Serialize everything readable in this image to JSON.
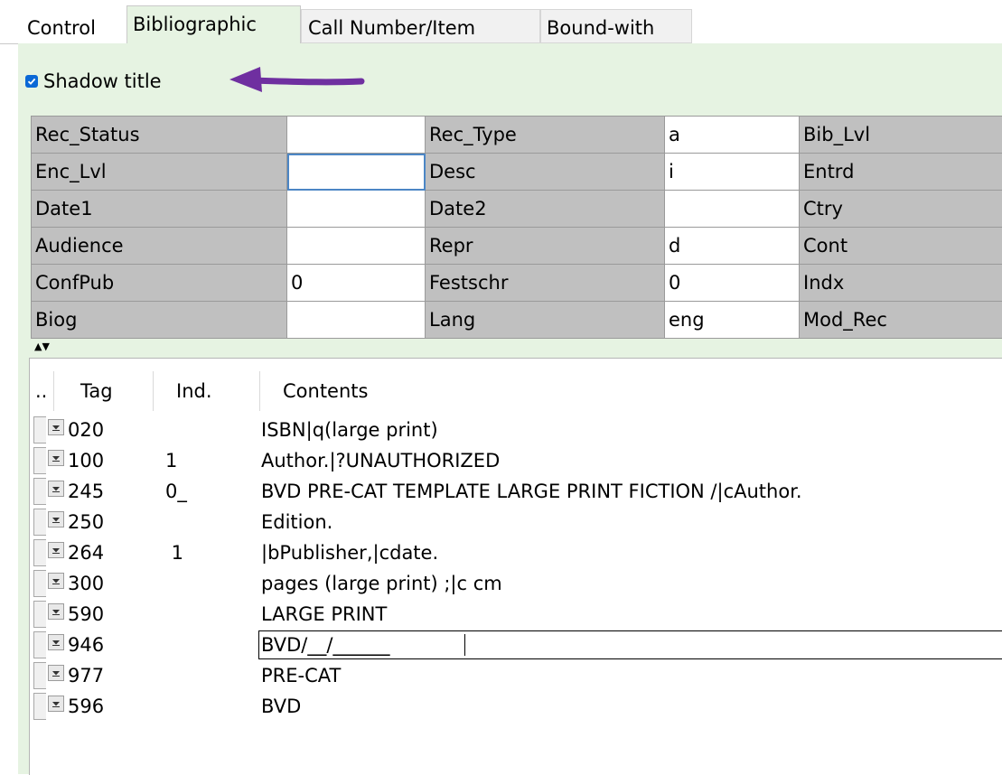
{
  "tabs": [
    "Control",
    "Bibliographic",
    "Call Number/Item",
    "Bound-with"
  ],
  "shadow_title": {
    "label": "Shadow title",
    "checked": true
  },
  "fixed_fields": [
    [
      "Rec_Status",
      "",
      "Rec_Type",
      "a",
      "Bib_Lvl"
    ],
    [
      "Enc_Lvl",
      "",
      "Desc",
      "i",
      "Entrd"
    ],
    [
      "Date1",
      "",
      "Date2",
      "",
      "Ctry"
    ],
    [
      "Audience",
      "",
      "Repr",
      "d",
      "Cont"
    ],
    [
      "ConfPub",
      "0",
      "Festschr",
      "0",
      "Indx"
    ],
    [
      "Biog",
      "",
      "Lang",
      "eng",
      "Mod_Rec"
    ]
  ],
  "var_fields": {
    "header": {
      "dot": "..",
      "tag": "Tag",
      "ind": "Ind.",
      "contents": "Contents"
    },
    "rows": [
      {
        "tag": "020",
        "ind": "",
        "contents": "ISBN|q(large print)"
      },
      {
        "tag": "100",
        "ind": "1",
        "contents": "Author.|?UNAUTHORIZED"
      },
      {
        "tag": "245",
        "ind": "0_",
        "contents": "BVD PRE-CAT TEMPLATE LARGE PRINT FICTION /|cAuthor."
      },
      {
        "tag": "250",
        "ind": "",
        "contents": "Edition."
      },
      {
        "tag": "264",
        "ind": " 1",
        "contents": "|bPublisher,|cdate."
      },
      {
        "tag": "300",
        "ind": "",
        "contents": "pages (large print) ;|c cm"
      },
      {
        "tag": "590",
        "ind": "",
        "contents": "LARGE PRINT"
      },
      {
        "tag": "946",
        "ind": "",
        "contents": "BVD/__/______"
      },
      {
        "tag": "977",
        "ind": "",
        "contents": "PRE-CAT"
      },
      {
        "tag": "596",
        "ind": "",
        "contents": "BVD"
      }
    ]
  },
  "colors": {
    "panel_bg": "#e6f3e2",
    "label_cell": "#c0c0c0",
    "arrow": "#6f2fa0",
    "checkbox": "#0b68d6"
  }
}
